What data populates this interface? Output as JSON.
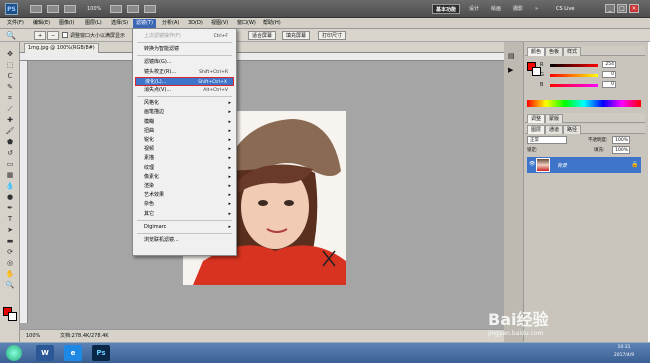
{
  "app": {
    "logo_text": "PS",
    "zoom": "100%",
    "workspace_active": "基本功能",
    "workspace_items": [
      "设计",
      "绘画",
      "摄影"
    ],
    "more": "»",
    "cs_live": "CS Live"
  },
  "menubar": [
    "文件(F)",
    "编辑(E)",
    "图像(I)",
    "图层(L)",
    "选择(S)",
    "滤镜(T)",
    "分析(A)",
    "3D(D)",
    "视图(V)",
    "窗口(W)",
    "帮助(H)"
  ],
  "options": {
    "checkbox_label": "调整窗口大小以满屏显示",
    "buttons": [
      "适合屏幕",
      "填充屏幕",
      "打印尺寸"
    ]
  },
  "document": {
    "tab_title": "1mg.jpg @ 100%(RGB/8#)",
    "status_zoom": "100%",
    "status_doc": "文档:278.4K/278.4K"
  },
  "filter_menu": {
    "items": [
      {
        "label": "上次滤镜操作(F)",
        "shortcut": "Ctrl+F",
        "disabled": true
      },
      {
        "sep": true
      },
      {
        "label": "转换为智能滤镜"
      },
      {
        "sep": true
      },
      {
        "label": "滤镜库(G)..."
      },
      {
        "label": "镜头校正(R)...",
        "shortcut": "Shift+Ctrl+R"
      },
      {
        "label": "液化(L)...",
        "shortcut": "Shift+Ctrl+X",
        "highlight": true
      },
      {
        "label": "消失点(V)...",
        "shortcut": "Alt+Ctrl+V"
      },
      {
        "sep": true
      },
      {
        "label": "风格化",
        "submenu": true
      },
      {
        "label": "画笔描边",
        "submenu": true
      },
      {
        "label": "模糊",
        "submenu": true
      },
      {
        "label": "扭曲",
        "submenu": true
      },
      {
        "label": "锐化",
        "submenu": true
      },
      {
        "label": "视频",
        "submenu": true
      },
      {
        "label": "素描",
        "submenu": true
      },
      {
        "label": "纹理",
        "submenu": true
      },
      {
        "label": "像素化",
        "submenu": true
      },
      {
        "label": "渲染",
        "submenu": true
      },
      {
        "label": "艺术效果",
        "submenu": true
      },
      {
        "label": "杂色",
        "submenu": true
      },
      {
        "label": "其它",
        "submenu": true
      },
      {
        "sep": true
      },
      {
        "label": "Digimarc",
        "submenu": true
      },
      {
        "sep": true
      },
      {
        "label": "浏览联机滤镜..."
      }
    ]
  },
  "color_panel": {
    "tabs": [
      "颜色",
      "色板",
      "样式"
    ],
    "sliders": [
      {
        "channel": "R",
        "value": "254"
      },
      {
        "channel": "G",
        "value": "0"
      },
      {
        "channel": "B",
        "value": "0"
      }
    ],
    "fg_color": "#fe0000"
  },
  "adjust_panel": {
    "tabs": [
      "调整",
      "蒙版"
    ]
  },
  "layers_panel": {
    "tabs": [
      "图层",
      "通道",
      "路径"
    ],
    "blend_mode": "正常",
    "opacity_label": "不透明度:",
    "opacity_value": "100%",
    "lock_label": "锁定:",
    "fill_label": "填充:",
    "fill_value": "100%",
    "layer_name": "背景"
  },
  "watermark": {
    "brand": "Bai经验",
    "url": "jingyan.baidu.com"
  },
  "taskbar": {
    "apps": [
      "W",
      "e",
      "Ps"
    ],
    "time": "10:31",
    "date": "2017/4/9"
  }
}
